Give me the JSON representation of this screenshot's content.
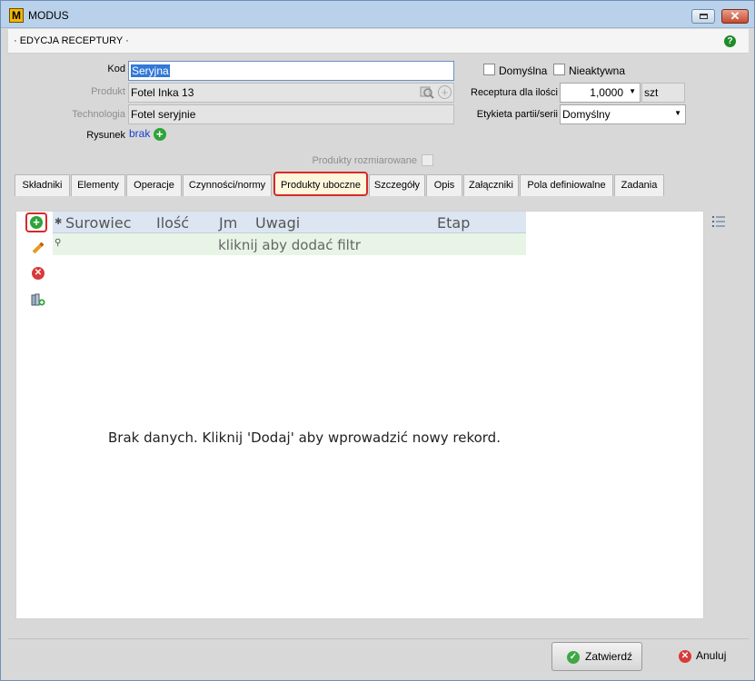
{
  "window": {
    "app_icon": "M",
    "title": "MODUS",
    "close_glyph": "✕"
  },
  "header": {
    "subtitle": "· EDYCJA RECEPTURY ·",
    "help_glyph": "?"
  },
  "form": {
    "kod_label": "Kod",
    "kod_value": "Seryjna",
    "produkt_label": "Produkt",
    "produkt_value": "Fotel Inka 13",
    "technologia_label": "Technologia",
    "technologia_value": "Fotel seryjnie",
    "rysunek_label": "Rysunek",
    "rysunek_value": "brak",
    "domyslna_label": "Domyślna",
    "nieaktywna_label": "Nieaktywna",
    "receptura_label": "Receptura dla ilości",
    "receptura_value": "1,0000",
    "receptura_unit": "szt",
    "etykieta_label": "Etykieta partii/serii",
    "etykieta_value": "Domyślny",
    "rozmiarowane_label": "Produkty rozmiarowane"
  },
  "tabs": [
    {
      "label": "Składniki"
    },
    {
      "label": "Elementy"
    },
    {
      "label": "Operacje"
    },
    {
      "label": "Czynności/normy"
    },
    {
      "label": "Produkty uboczne"
    },
    {
      "label": "Szczegóły"
    },
    {
      "label": "Opis"
    },
    {
      "label": "Załączniki"
    },
    {
      "label": "Pola definiowalne"
    },
    {
      "label": "Zadania"
    }
  ],
  "grid": {
    "columns": [
      "Surowiec",
      "Ilość",
      "Jm",
      "Uwagi",
      "Etap"
    ],
    "filter_text": "kliknij aby dodać filtr",
    "empty_message": "Brak danych. Kliknij 'Dodaj' aby wprowadzić nowy rekord."
  },
  "footer": {
    "ok_label": "Zatwierdź",
    "cancel_label": "Anuluj"
  }
}
